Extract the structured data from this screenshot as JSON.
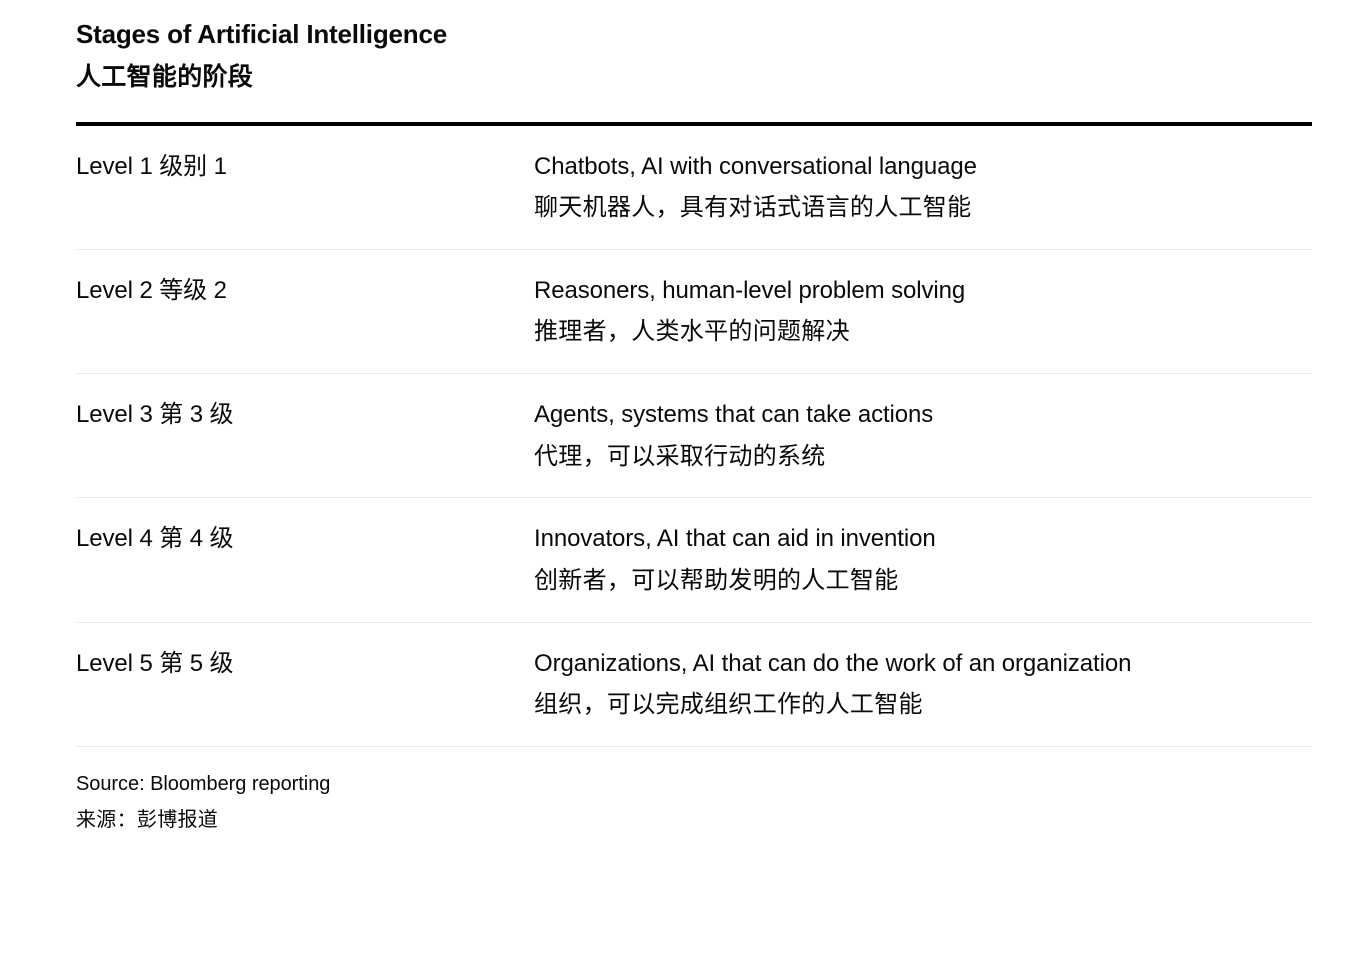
{
  "header": {
    "title_en": "Stages of Artificial Intelligence",
    "title_zh": "人工智能的阶段"
  },
  "rows": [
    {
      "level_en": "Level 1  级别 1",
      "desc_en": "Chatbots, AI with conversational language",
      "desc_zh": "聊天机器人，具有对话式语言的人工智能"
    },
    {
      "level_en": "Level 2  等级 2",
      "desc_en": "Reasoners, human-level problem solving",
      "desc_zh": "推理者，人类水平的问题解决"
    },
    {
      "level_en": "Level 3  第 3 级",
      "desc_en": "Agents, systems that can take actions",
      "desc_zh": "代理，可以采取行动的系统"
    },
    {
      "level_en": "Level 4  第 4 级",
      "desc_en": "Innovators, AI that can aid in invention",
      "desc_zh": "创新者，可以帮助发明的人工智能"
    },
    {
      "level_en": "Level 5  第 5 级",
      "desc_en": "Organizations, AI that can do the work of an organization",
      "desc_zh": "组织，可以完成组织工作的人工智能"
    }
  ],
  "source": {
    "text_en": "Source: Bloomberg reporting",
    "text_zh": "来源：彭博报道"
  },
  "colors": {
    "background": "#ffffff",
    "text": "#0a0a0a",
    "rule_thick": "#000000",
    "rule_thin": "#ececec"
  }
}
